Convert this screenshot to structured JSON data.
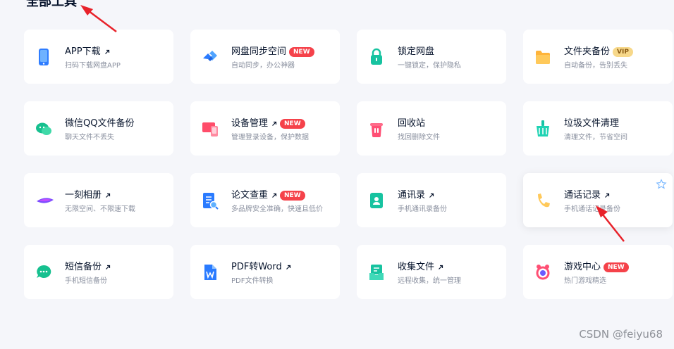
{
  "section": {
    "title": "全部工具"
  },
  "tools": [
    {
      "title": "APP下载",
      "desc": "扫码下载网盘APP",
      "badge": "",
      "external": true,
      "icon": "phone-icon"
    },
    {
      "title": "网盘同步空间",
      "desc": "自动同步，办公神器",
      "badge": "NEW",
      "external": false,
      "icon": "sync-icon"
    },
    {
      "title": "锁定网盘",
      "desc": "一键锁定，保护隐私",
      "badge": "",
      "external": false,
      "icon": "lock-icon"
    },
    {
      "title": "文件夹备份",
      "desc": "自动备份，告别丢失",
      "badge": "VIP",
      "external": false,
      "icon": "folder-icon"
    },
    {
      "title": "微信QQ文件备份",
      "desc": "聊天文件不丢失",
      "badge": "",
      "external": false,
      "icon": "chat-icon"
    },
    {
      "title": "设备管理",
      "desc": "管理登录设备，保护数据",
      "badge": "NEW",
      "external": true,
      "icon": "devices-icon"
    },
    {
      "title": "回收站",
      "desc": "找回删除文件",
      "badge": "",
      "external": false,
      "icon": "recycle-bin-icon"
    },
    {
      "title": "垃圾文件清理",
      "desc": "清理文件，节省空间",
      "badge": "",
      "external": false,
      "icon": "clean-icon"
    },
    {
      "title": "一刻相册",
      "desc": "无限空间、不限速下载",
      "badge": "",
      "external": true,
      "icon": "album-icon"
    },
    {
      "title": "论文查重",
      "desc": "多品牌安全准确，快速且低价",
      "badge": "NEW",
      "external": true,
      "icon": "paper-check-icon"
    },
    {
      "title": "通讯录",
      "desc": "手机通讯录备份",
      "badge": "",
      "external": true,
      "icon": "contacts-icon"
    },
    {
      "title": "通话记录",
      "desc": "手机通话记录备份",
      "badge": "",
      "external": true,
      "icon": "call-log-icon"
    },
    {
      "title": "短信备份",
      "desc": "手机短信备份",
      "badge": "",
      "external": true,
      "icon": "sms-icon"
    },
    {
      "title": "PDF转Word",
      "desc": "PDF文件转换",
      "badge": "",
      "external": true,
      "icon": "pdf-word-icon"
    },
    {
      "title": "收集文件",
      "desc": "远程收集，统一管理",
      "badge": "",
      "external": true,
      "icon": "collect-icon"
    },
    {
      "title": "游戏中心",
      "desc": "热门游戏精选",
      "badge": "NEW",
      "external": false,
      "icon": "game-icon"
    }
  ],
  "watermark": "CSDN @feiyu68",
  "colors": {
    "badge_new": "#f5424a",
    "badge_vip": "#f7d88a",
    "annotation_arrow": "#e8222a"
  }
}
